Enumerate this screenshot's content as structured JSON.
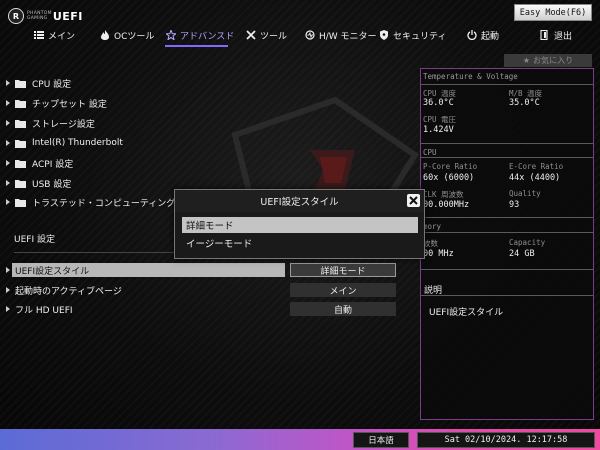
{
  "logo": {
    "mark": "R",
    "line1": "PHANTOM",
    "line2": "GAMING",
    "product": "UEFI"
  },
  "easy_mode_button": "Easy Mode(F6)",
  "tabs": [
    {
      "label": "メイン",
      "icon": "list-icon"
    },
    {
      "label": "OCツール",
      "icon": "flame-icon"
    },
    {
      "label": "アドバンスド",
      "icon": "star-icon",
      "active": true
    },
    {
      "label": "ツール",
      "icon": "tools-icon"
    },
    {
      "label": "H/W モニター",
      "icon": "monitor-icon"
    },
    {
      "label": "セキュリティ",
      "icon": "shield-icon"
    },
    {
      "label": "起動",
      "icon": "power-icon"
    },
    {
      "label": "退出",
      "icon": "exit-icon"
    }
  ],
  "favorites_label": "お気に入り",
  "menu_items": [
    "CPU 設定",
    "チップセット 設定",
    "ストレージ設定",
    "Intel(R) Thunderbolt",
    "ACPI 設定",
    "USB 設定",
    "トラステッド・コンピューティング"
  ],
  "section_title": "UEFI 設定",
  "settings": [
    {
      "label": "UEFI設定スタイル",
      "value": "詳細モード",
      "selected": true
    },
    {
      "label": "起動時のアクティブページ",
      "value": "メイン",
      "selected": false
    },
    {
      "label": "フル HD UEFI",
      "value": "自動",
      "selected": false
    }
  ],
  "right_panel": {
    "temp_header": "Temperature & Voltage",
    "cpu_temp_label": "CPU 温度",
    "cpu_temp_value": "36.0°C",
    "mb_temp_label": "M/B 温度",
    "mb_temp_value": "35.0°C",
    "cpu_voltage_label": "CPU 電圧",
    "cpu_voltage_value": "1.424V",
    "cpu_header": "CPU",
    "pcore_label": "P-Core Ratio",
    "pcore_value": "60x (6000)",
    "ecore_label": "E-Core Ratio",
    "ecore_value": "44x (4400)",
    "bclk_label": "CLK 周波数",
    "bclk_value": "00.000MHz",
    "quality_label": "Quality",
    "quality_value": "93",
    "memory_header": "mory",
    "freq_label": "波数",
    "freq_value": "00 MHz",
    "capacity_label": "Capacity",
    "capacity_value": "24 GB",
    "desc_title": "説明",
    "desc_text": "UEFI設定スタイル"
  },
  "dialog": {
    "title": "UEFI設定スタイル",
    "options": [
      "詳細モード",
      "イージーモード"
    ],
    "selected_index": 0
  },
  "bottom": {
    "language": "日本語",
    "datetime": "Sat 02/10/2024. 12:17:58"
  },
  "colors": {
    "accent": "#7d6cff",
    "panel_border": "#7a3c8a",
    "selection": "#c4c4c4",
    "bottom_gradient_start": "#5b6bd6",
    "bottom_gradient_end": "#f04aa0"
  }
}
